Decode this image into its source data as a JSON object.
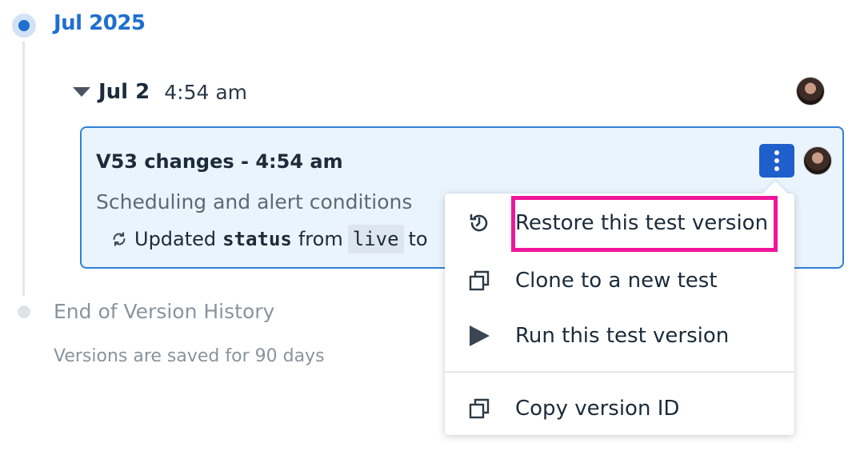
{
  "timeline": {
    "month": "Jul 2025",
    "day": "Jul 2",
    "day_time": "4:54 am"
  },
  "version_card": {
    "title": "V53 changes - 4:54 am",
    "subtitle": "Scheduling and alert conditions",
    "change_prefix": "Updated",
    "change_field": "status",
    "change_from": "from",
    "change_value": "live",
    "change_to": "to"
  },
  "end": {
    "label": "End of Version History",
    "note": "Versions are saved for 90 days"
  },
  "menu": {
    "items": [
      {
        "label": "Restore this test version",
        "icon": "restore-history-icon"
      },
      {
        "label": "Clone to a new test",
        "icon": "clone-icon"
      },
      {
        "label": "Run this test version",
        "icon": "play-icon"
      },
      {
        "label": "Copy version ID",
        "icon": "copy-icon"
      }
    ]
  },
  "colors": {
    "accent": "#1f6fcf",
    "card_bg": "#e9f4fd",
    "kebab_bg": "#1f5fcc",
    "highlight": "#f0169a"
  }
}
